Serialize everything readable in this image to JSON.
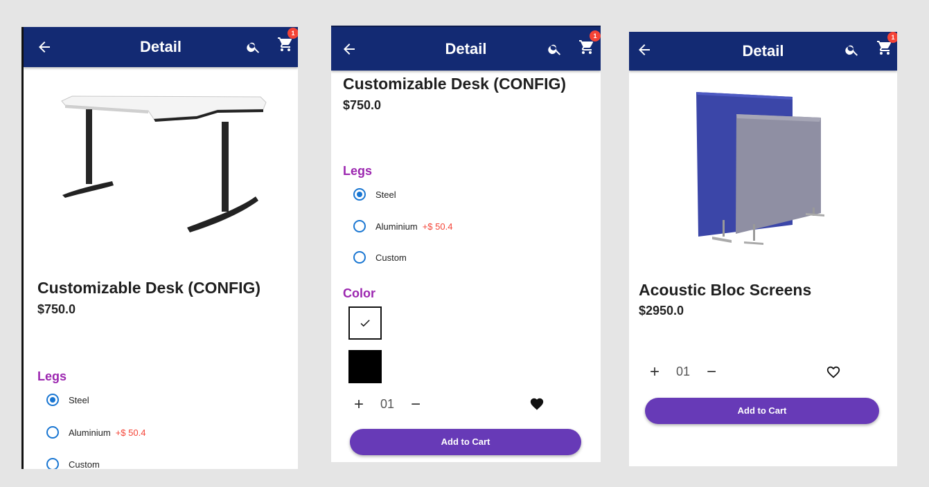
{
  "app_title": "Detail",
  "cart_count": "1",
  "icons": [
    "back-arrow-icon",
    "search-icon",
    "shopping-cart-icon",
    "check-icon",
    "plus-icon",
    "minus-icon",
    "heart-icon"
  ],
  "colors": {
    "app_bar": "#132a73",
    "section_label": "#9c27b0",
    "radio_selected": "#1976d2",
    "extra_price": "#f44336",
    "add_to_cart": "#673ab7",
    "badge": "#f44336"
  },
  "screens": [
    {
      "product_name": "Customizable Desk (CONFIG)",
      "price": "$750.0",
      "legs_label": "Legs",
      "legs_options": [
        {
          "label": "Steel",
          "extra": "",
          "selected": true
        },
        {
          "label": "Aluminium",
          "extra": "+$ 50.4",
          "selected": false
        },
        {
          "label": "Custom",
          "extra": "",
          "selected": false
        }
      ]
    },
    {
      "product_name": "Customizable Desk (CONFIG)",
      "price": "$750.0",
      "legs_label": "Legs",
      "legs_options": [
        {
          "label": "Steel",
          "extra": "",
          "selected": true
        },
        {
          "label": "Aluminium",
          "extra": "+$ 50.4",
          "selected": false
        },
        {
          "label": "Custom",
          "extra": "",
          "selected": false
        }
      ],
      "color_label": "Color",
      "color_options": [
        {
          "color": "#ffffff",
          "selected": true
        },
        {
          "color": "#000000",
          "selected": false
        }
      ],
      "quantity": "01",
      "favorite": true,
      "add_to_cart_label": "Add to Cart"
    },
    {
      "product_name": "Acoustic Bloc Screens",
      "price": "$2950.0",
      "quantity": "01",
      "favorite": false,
      "add_to_cart_label": "Add to Cart"
    }
  ]
}
